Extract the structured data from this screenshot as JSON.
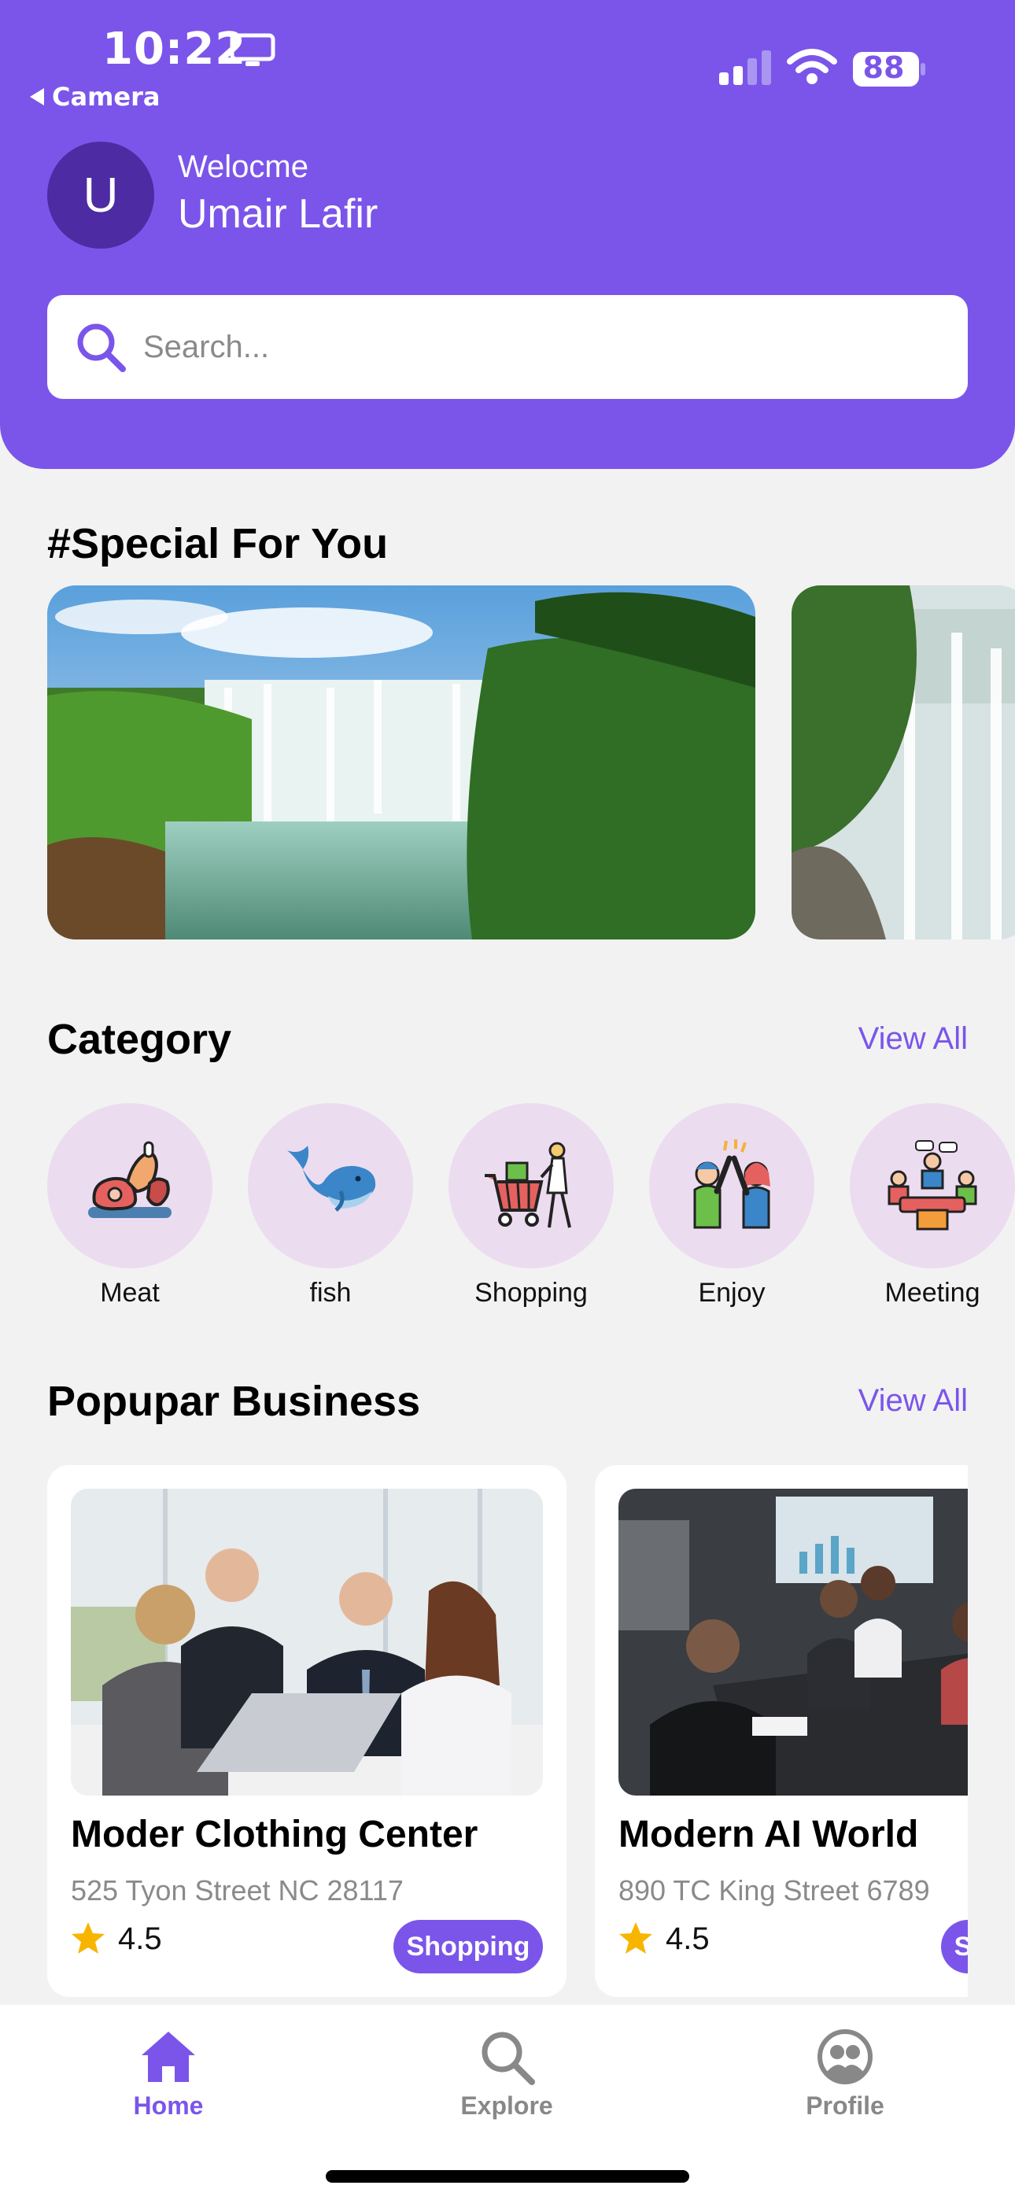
{
  "status_bar": {
    "time": "10:22",
    "back_label": "Camera",
    "battery": "88"
  },
  "header": {
    "avatar_initial": "U",
    "greeting": "Welocme",
    "user_name": "Umair Lafir",
    "search_placeholder": "Search..."
  },
  "special": {
    "title": "#Special For You"
  },
  "category": {
    "title": "Category",
    "view_all": "View All",
    "items": [
      {
        "label": "Meat",
        "icon": "meat-icon"
      },
      {
        "label": "fish",
        "icon": "whale-icon"
      },
      {
        "label": "Shopping",
        "icon": "shopping-cart-icon"
      },
      {
        "label": "Enjoy",
        "icon": "high-five-icon"
      },
      {
        "label": "Meeting",
        "icon": "meeting-icon"
      }
    ]
  },
  "business": {
    "title": "Popupar Business",
    "view_all": "View All",
    "cards": [
      {
        "name": "Moder Clothing Center",
        "address": "525 Tyon Street NC 28117",
        "rating": "4.5",
        "tag": "Shopping"
      },
      {
        "name": "Modern AI World",
        "address": "890 TC King Street 6789",
        "rating": "4.5",
        "tag": "Shopping"
      }
    ]
  },
  "nav": {
    "items": [
      {
        "label": "Home",
        "icon": "home-icon",
        "active": true
      },
      {
        "label": "Explore",
        "icon": "search-icon",
        "active": false
      },
      {
        "label": "Profile",
        "icon": "profile-icon",
        "active": false
      }
    ]
  },
  "colors": {
    "accent": "#7b55ea",
    "header_bg": "#7b55ea",
    "category_bg": "#ecdcf0",
    "inactive_nav": "#888888",
    "star": "#f7b500"
  }
}
